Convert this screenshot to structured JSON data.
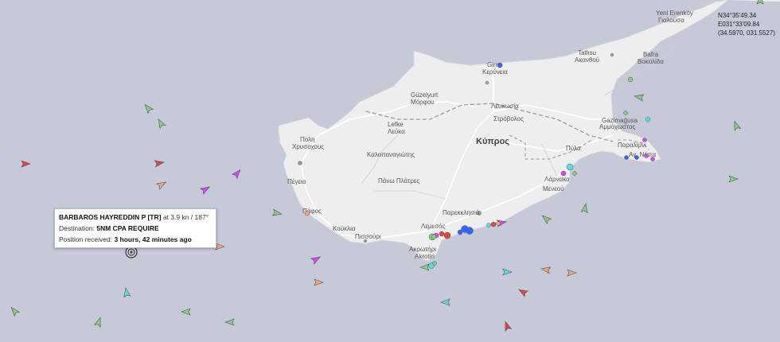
{
  "coordinates": {
    "lat": "N34°35'49.34",
    "lon": "E031°33'09.84",
    "decimal": "(34.5970, 031.5527)"
  },
  "tooltip": {
    "name": "BARBAROS HAYREDDIN P [TR]",
    "speed": " at 3.9 kn / 187°",
    "destination_label": "Destination: ",
    "destination_value": "5NM CPA REQUIRE",
    "position_label": "Position received: ",
    "position_value": "3 hours, 42 minutes ago"
  },
  "places": {
    "country": "Κύπρος",
    "yeni_erenkoy": "Yeni Erenköy",
    "gialousa": "Γιαλούσα",
    "tatlisu": "Tatlısu",
    "akanthou": "Ακανθού",
    "bafra": "Bafra",
    "vokolida": "Βοκολίδα",
    "girne": "Girne",
    "kyreneia": "Κερύνεια",
    "guzelyurt": "Güzelyurt",
    "morfou": "Μόρφου",
    "lefkosia": "Λευκωσία",
    "strovolos": "Στρόβολος",
    "lefke": "Lefke",
    "lefka": "Λεύκα",
    "gazimagusa": "Gazimağusa",
    "ammochostos": "Αμμόχωστος",
    "polis": "Πολη",
    "chrysochous": "Χρυσοχους",
    "kalopanagiotis": "Καλοπαναγιώτης",
    "pyla": "Πύλα",
    "paralimni": "Παραλίμνι",
    "ayia_napa": "Αγ. Νάπα",
    "peyia": "Πέγεια",
    "pano_platres": "Πάνω Πλάτρες",
    "larnaka": "Λάρνακα",
    "meneou": "Μενεού",
    "pafos": "Πάφος",
    "parekklisia": "Παρεκκλησιά",
    "kouklia": "Κούκλια",
    "lemesos": "Λεμεσός",
    "pissouri": "Πισσούρι",
    "akrotiri_gr": "Ακρωτήρι",
    "akrotiri": "Akrotiri"
  },
  "colors": {
    "sea": "#c6c9d8",
    "land": "#eeeeee",
    "cargo": "#7fd17f",
    "tanker": "#e8433f",
    "passenger": "#3366ff",
    "pleasure": "#e040fb",
    "fishing": "#f4a27a",
    "tug": "#53e0e6"
  },
  "icons": {
    "selected_vessel": "target-ring-icon",
    "vessel": "ship-arrow-icon"
  }
}
